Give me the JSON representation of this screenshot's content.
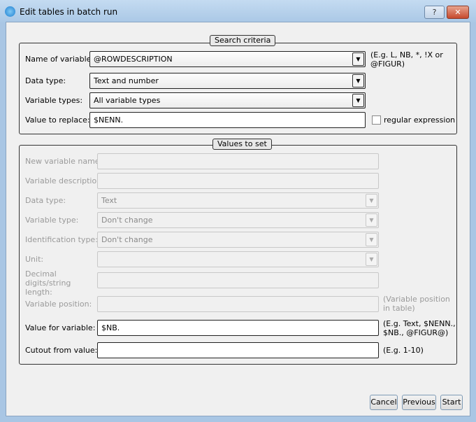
{
  "window": {
    "title": "Edit tables in batch run",
    "help": "?",
    "close": "✕"
  },
  "search": {
    "legend": "Search criteria",
    "name_label": "Name of variable:",
    "name_value": "@ROWDESCRIPTION",
    "name_hint": "(E.g. L, NB, *, !X or @FIGUR)",
    "type_label": "Data type:",
    "type_value": "Text and number",
    "vartypes_label": "Variable types:",
    "vartypes_value": "All variable types",
    "replace_label": "Value to replace:",
    "replace_value": "$NENN.",
    "regex_label": "regular expression",
    "regex_checked": false
  },
  "values": {
    "legend": "Values to set",
    "new_name_label": "New variable name:",
    "new_name_value": "",
    "desc_label": "Variable description:",
    "desc_value": "",
    "data_type_label": "Data type:",
    "data_type_value": "Text",
    "var_type_label": "Variable type:",
    "var_type_value": "Don't change",
    "ident_label": "Identification type:",
    "ident_value": "Don't change",
    "unit_label": "Unit:",
    "unit_value": "",
    "decimal_label": "Decimal digits/string length:",
    "decimal_value": "",
    "position_label": "Variable position:",
    "position_value": "",
    "position_hint": "(Variable position in table)",
    "value_label": "Value for variable:",
    "value_value": "$NB.",
    "value_hint": "(E.g. Text, $NENN., $NB., @FIGUR@)",
    "cutout_label": "Cutout from value:",
    "cutout_value": "",
    "cutout_hint": "(E.g. 1-10)"
  },
  "buttons": {
    "cancel": "Cancel",
    "previous": "Previous",
    "start": "Start"
  }
}
